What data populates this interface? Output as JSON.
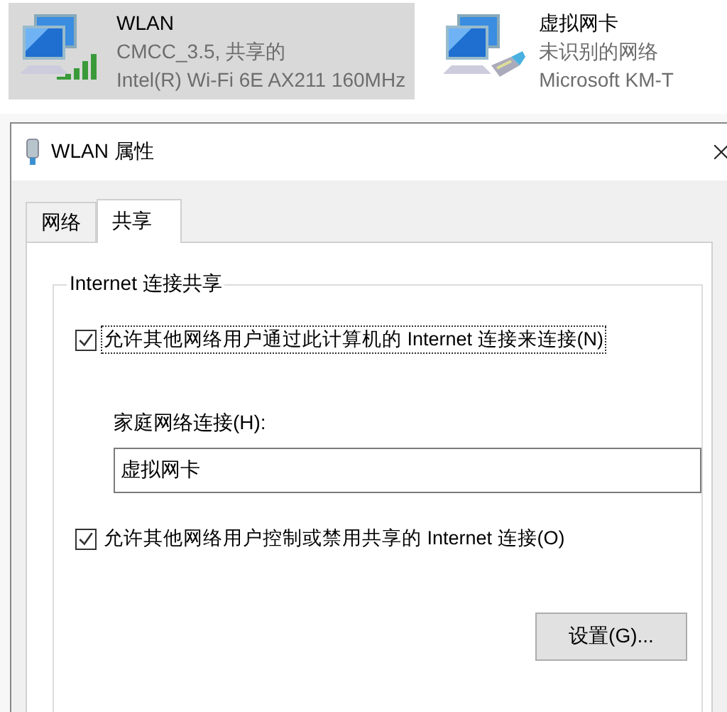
{
  "connections": [
    {
      "name": "WLAN",
      "status": "CMCC_3.5, 共享的",
      "device": "Intel(R) Wi-Fi 6E AX211 160MHz",
      "kind": "wifi",
      "selected": true
    },
    {
      "name": "虚拟网卡",
      "status": "未识别的网络",
      "device": "Microsoft KM-T",
      "kind": "ethernet",
      "selected": false
    }
  ],
  "window": {
    "title": "WLAN 属性"
  },
  "tabs": [
    {
      "label": "网络",
      "selected": false
    },
    {
      "label": "共享",
      "selected": true
    }
  ],
  "group": {
    "title": "Internet 连接共享",
    "options": [
      {
        "label": "允许其他网络用户通过此计算机的 Internet 连接来连接(N)",
        "checked": true,
        "focused": true
      },
      {
        "label": "允许其他网络用户控制或禁用共享的 Internet 连接(O)",
        "checked": true,
        "focused": false
      }
    ],
    "home_connection": {
      "label": "家庭网络连接(H):",
      "value": "虚拟网卡"
    },
    "button": "设置(G)..."
  }
}
